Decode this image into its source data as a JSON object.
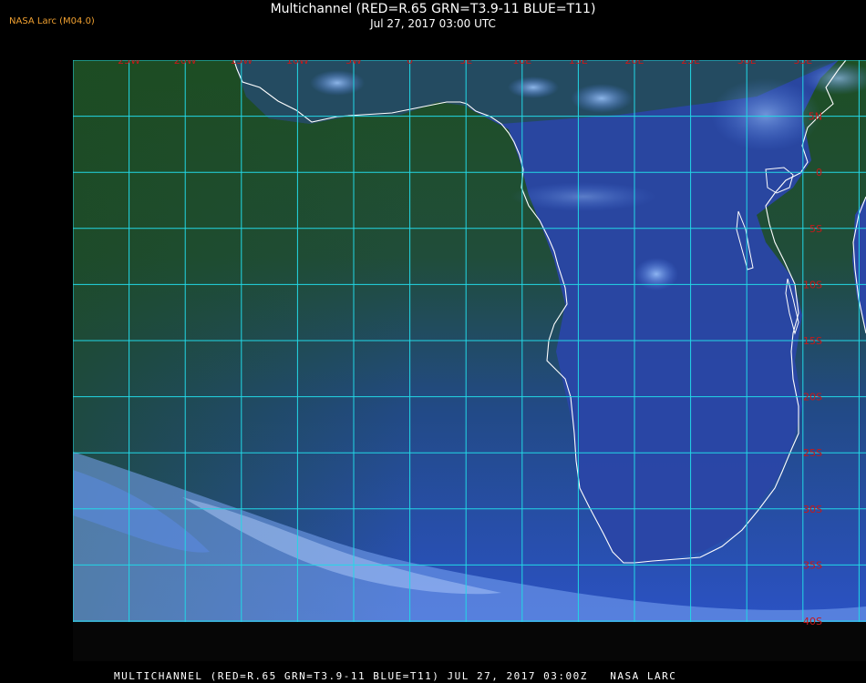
{
  "header": {
    "version": "NASA Larc (M04.0)",
    "title": "Multichannel (RED=R.65 GRN=T3.9-11 BLUE=T11)",
    "subtitle": "Jul 27, 2017 03:00 UTC"
  },
  "footer": {
    "caption": "MULTICHANNEL (RED=R.65 GRN=T3.9-11 BLUE=T11) JUL 27, 2017 03:00Z   NASA LARC"
  },
  "map": {
    "lon_labels": [
      "25W",
      "20W",
      "15W",
      "10W",
      "5W",
      "0",
      "5E",
      "10E",
      "15E",
      "20E",
      "25E",
      "30E",
      "35E"
    ],
    "lat_labels": [
      "5N",
      "0",
      "5S",
      "10S",
      "15S",
      "20S",
      "25S",
      "30S",
      "35S",
      "40S"
    ],
    "colors": {
      "grid": "#22d8e6",
      "label": "#c81818",
      "coast": "#ffffff",
      "ocean_north": "#1f4a22",
      "ocean_south": "#2a55c8",
      "land": "#2e48a8"
    }
  }
}
